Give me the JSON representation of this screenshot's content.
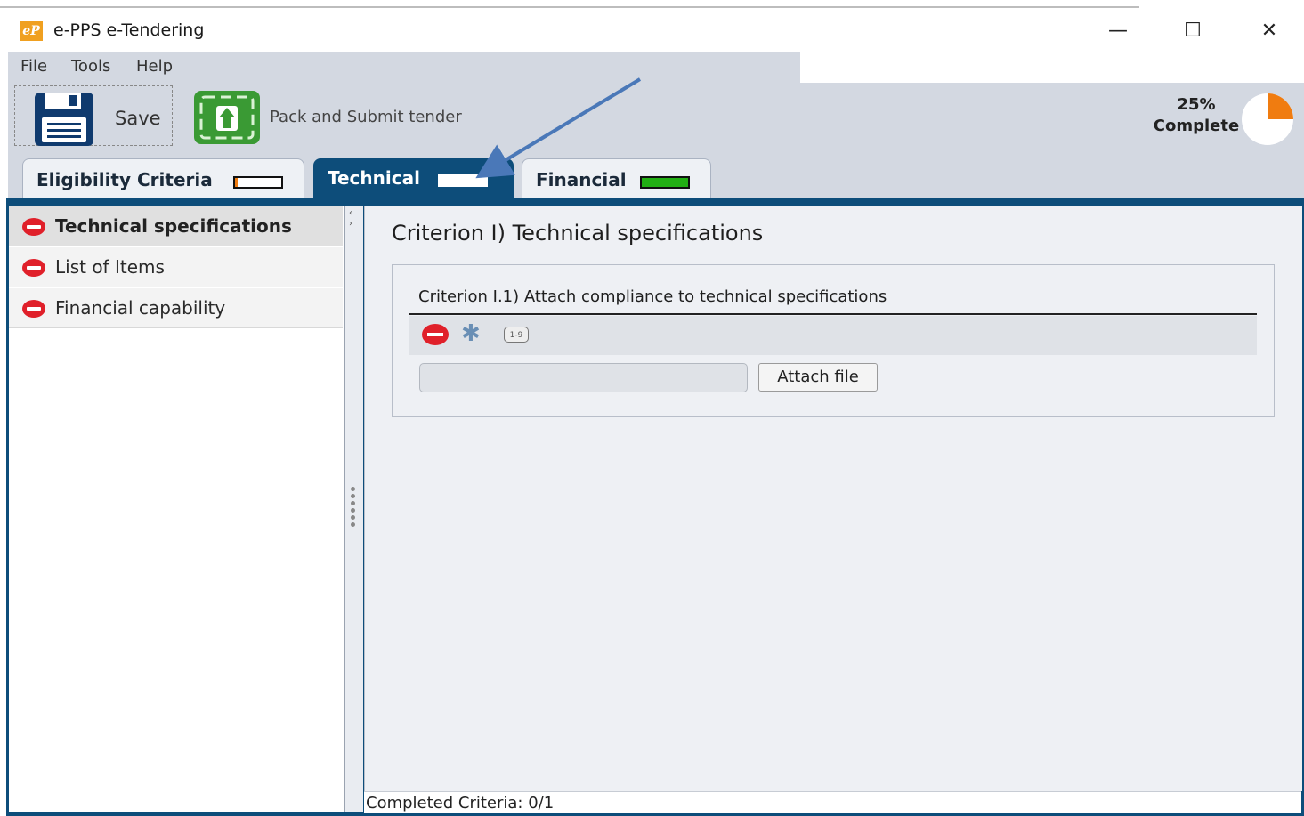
{
  "window": {
    "title": "e-PPS e-Tendering",
    "logo_text": "eP",
    "controls": {
      "minimize": "—",
      "maximize": "☐",
      "close": "✕"
    }
  },
  "menu": {
    "items": [
      "File",
      "Tools",
      "Help"
    ]
  },
  "toolbar": {
    "save_label": "Save",
    "submit_label": "Pack and Submit tender",
    "progress_percent_text": "25%",
    "progress_complete_text": "Complete",
    "progress_value": 0.25,
    "progress_color": "#f07c10"
  },
  "tabs": [
    {
      "label": "Eligibility Criteria",
      "status_fill": 0.05,
      "fill_color": "#f07c10",
      "active": false
    },
    {
      "label": "Technical",
      "status_fill": 0.0,
      "fill_color": "#ffffff",
      "active": true
    },
    {
      "label": "Financial",
      "status_fill": 1.0,
      "fill_color": "#22b014",
      "active": false
    }
  ],
  "sidebar": {
    "items": [
      {
        "label": "Technical specifications",
        "icon": "stop-icon",
        "selected": true
      },
      {
        "label": "List of Items",
        "icon": "stop-icon",
        "selected": false
      },
      {
        "label": "Financial capability",
        "icon": "stop-icon",
        "selected": false
      }
    ],
    "collapse_arrows": "‹ ›"
  },
  "content": {
    "criterion_title": "Criterion I) Technical specifications",
    "sub_criterion_title": "Criterion I.1) Attach compliance to technical specifications",
    "icons": [
      "stop-icon",
      "asterisk-icon",
      "number-range-icon"
    ],
    "number_icon_text": "1-9",
    "file_field_value": "",
    "attach_button_label": "Attach file"
  },
  "status": {
    "completed_criteria": "Completed Criteria: 0/1"
  },
  "colors": {
    "frame": "#0d4d7a",
    "chrome": "#d3d8e1",
    "stop_red": "#e0202a",
    "annotation_arrow": "#4a78b8"
  }
}
